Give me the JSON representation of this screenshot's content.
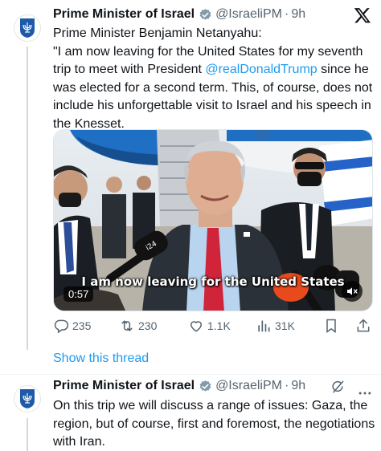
{
  "colors": {
    "accent": "#1d9bf0",
    "verified_gray": "#829aab",
    "text": "#0f1419",
    "muted": "#536471"
  },
  "tweet1": {
    "name": "Prime Minister of Israel",
    "handle": "@IsraeliPM",
    "dot": "·",
    "time": "9h",
    "line1": "Prime Minister Benjamin Netanyahu:",
    "text_before": "\"I am now leaving for the United States for my seventh trip to meet with President ",
    "mention": "@realDonaldTrump",
    "text_after": " since he was elected for a second term. This, of course, does not include his unforgettable visit to Israel and his speech in the Knesset.",
    "video": {
      "caption": "I am now leaving for the United States",
      "duration": "0:57"
    },
    "actions": {
      "replies": "235",
      "reposts": "230",
      "likes": "1.1K",
      "views": "31K"
    },
    "show_thread": "Show this thread"
  },
  "tweet2": {
    "name": "Prime Minister of Israel",
    "handle": "@IsraeliPM",
    "dot": "·",
    "time": "9h",
    "text": "On this trip we will discuss a range of issues: Gaza, the region, but of course, first and foremost, the negotiations with Iran."
  },
  "icons": {
    "avatar": "israel-emblem-icon",
    "verified": "verified-badge-icon",
    "logo": "x-logo-icon",
    "reply": "reply-icon",
    "repost": "repost-icon",
    "like": "heart-icon",
    "views": "views-chart-icon",
    "bookmark": "bookmark-icon",
    "share": "share-icon",
    "mute": "muted-speaker-icon",
    "more": "more-icon",
    "grok": "grok-icon"
  }
}
